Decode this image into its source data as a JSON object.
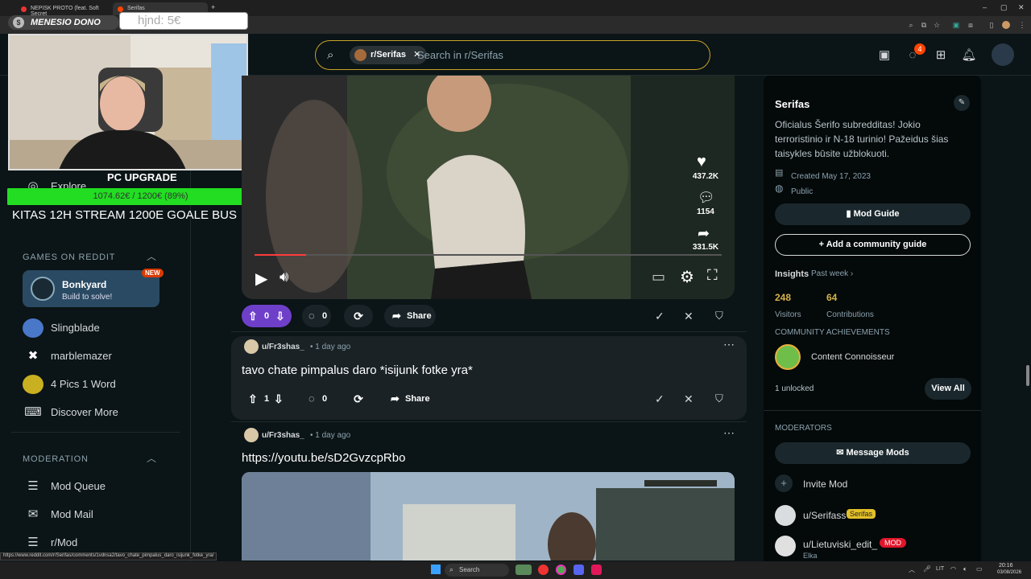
{
  "browser": {
    "tabs": [
      "NEPISK PROTO (feat. Soft Secret",
      "Serifas"
    ],
    "status_url": "https://www.reddit.com/r/Serifas/comments/1vdnsa2/tavo_chate_pimpalus_daro_isijunk_fotke_yra/"
  },
  "stream_overlay": {
    "donation_label": "MENESIO DONO",
    "donation_value": "hjnd: 5€",
    "goal_title": "PC UPGRADE",
    "goal_progress_text": "1074.62€ / 1200€ (89%)",
    "goal_progress": 0.89,
    "goal_caption": "KITAS 12H STREAM 1200E GOALE BUS"
  },
  "header": {
    "chip_label": "r/Serifas",
    "search_placeholder": "Search in r/Serifas",
    "chat_badge": "4"
  },
  "left_sidebar": {
    "explore_label": "Explore",
    "games_title": "GAMES ON REDDIT",
    "featured_game": {
      "name": "Bonkyard",
      "sub": "Build to solve!",
      "badge": "NEW"
    },
    "games": [
      "Slingblade",
      "marblemazer",
      "4 Pics 1 Word",
      "Discover More"
    ],
    "moderation_title": "MODERATION",
    "mod_items": [
      "Mod Queue",
      "Mod Mail",
      "r/Mod"
    ]
  },
  "video": {
    "likes": "437.2K",
    "comments": "1154",
    "shares": "331.5K",
    "progress": 0.11
  },
  "post1_actions": {
    "votes": "0",
    "comments": "0",
    "share": "Share"
  },
  "post2": {
    "author": "u/Fr3shas_",
    "time": "1 day ago",
    "title": "tavo chate pimpalus daro *isijunk fotke yra*",
    "votes": "1",
    "comments": "0",
    "share": "Share"
  },
  "post3": {
    "author": "u/Fr3shas_",
    "time": "1 day ago",
    "title": "https://youtu.be/sD2GvzcpRbo"
  },
  "community": {
    "name": "Serifas",
    "description": "Oficialus Šerifo subredditas! Jokio terroristinio ir N-18 turinio! Pažeidus šias taisykles būsite užblokuoti.",
    "created": "Created May 17, 2023",
    "visibility": "Public",
    "mod_guide": "Mod Guide",
    "add_guide": "Add a community guide",
    "insights": "Insights",
    "insights_range": "Past week",
    "visitors_value": "248",
    "visitors_label": "Visitors",
    "contrib_value": "64",
    "contrib_label": "Contributions",
    "achievements_title": "COMMUNITY ACHIEVEMENTS",
    "achievement": "Content Connoisseur",
    "unlocked": "1 unlocked",
    "view_all": "View All",
    "moderators_title": "MODERATORS",
    "message_mods": "Message Mods",
    "invite_mod": "Invite Mod",
    "mods": [
      {
        "name": "u/Serifass",
        "flair": "Serifas"
      },
      {
        "name": "u/Lietuviski_edit_",
        "flair": "MOD",
        "sub": "Elka"
      }
    ]
  },
  "taskbar": {
    "search": "Search",
    "lang": "LIT",
    "time": "20:16",
    "date": "03/08/2026"
  },
  "colors": {
    "accent": "#6e40c9",
    "upvote_bg": "#6e40c9",
    "goal_green": "#22dd22",
    "search_border": "#c9a227"
  }
}
